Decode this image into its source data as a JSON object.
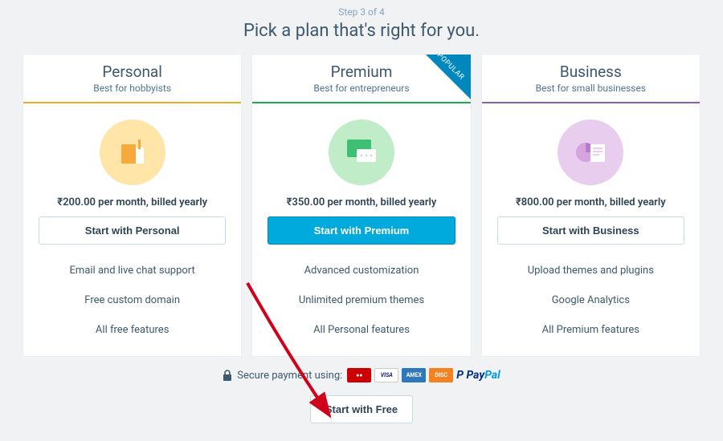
{
  "step": "Step 3 of 4",
  "title": "Pick a plan that's right for you.",
  "plans": [
    {
      "name": "Personal",
      "tag": "Best for hobbyists",
      "price": "₹200.00 per month, billed yearly",
      "cta": "Start with Personal",
      "features": [
        "Email and live chat support",
        "Free custom domain",
        "All free features"
      ],
      "popular": ""
    },
    {
      "name": "Premium",
      "tag": "Best for entrepreneurs",
      "price": "₹350.00 per month, billed yearly",
      "cta": "Start with Premium",
      "features": [
        "Advanced customization",
        "Unlimited premium themes",
        "All Personal features"
      ],
      "popular": "POPULAR"
    },
    {
      "name": "Business",
      "tag": "Best for small businesses",
      "price": "₹800.00 per month, billed yearly",
      "cta": "Start with Business",
      "features": [
        "Upload themes and plugins",
        "Google Analytics",
        "All Premium features"
      ],
      "popular": ""
    }
  ],
  "secure": {
    "label": "Secure payment using:",
    "methods": [
      "MasterCard",
      "VISA",
      "AMEX",
      "DISCOVER",
      "PayPal"
    ]
  },
  "free": {
    "cta": "Start with Free"
  }
}
